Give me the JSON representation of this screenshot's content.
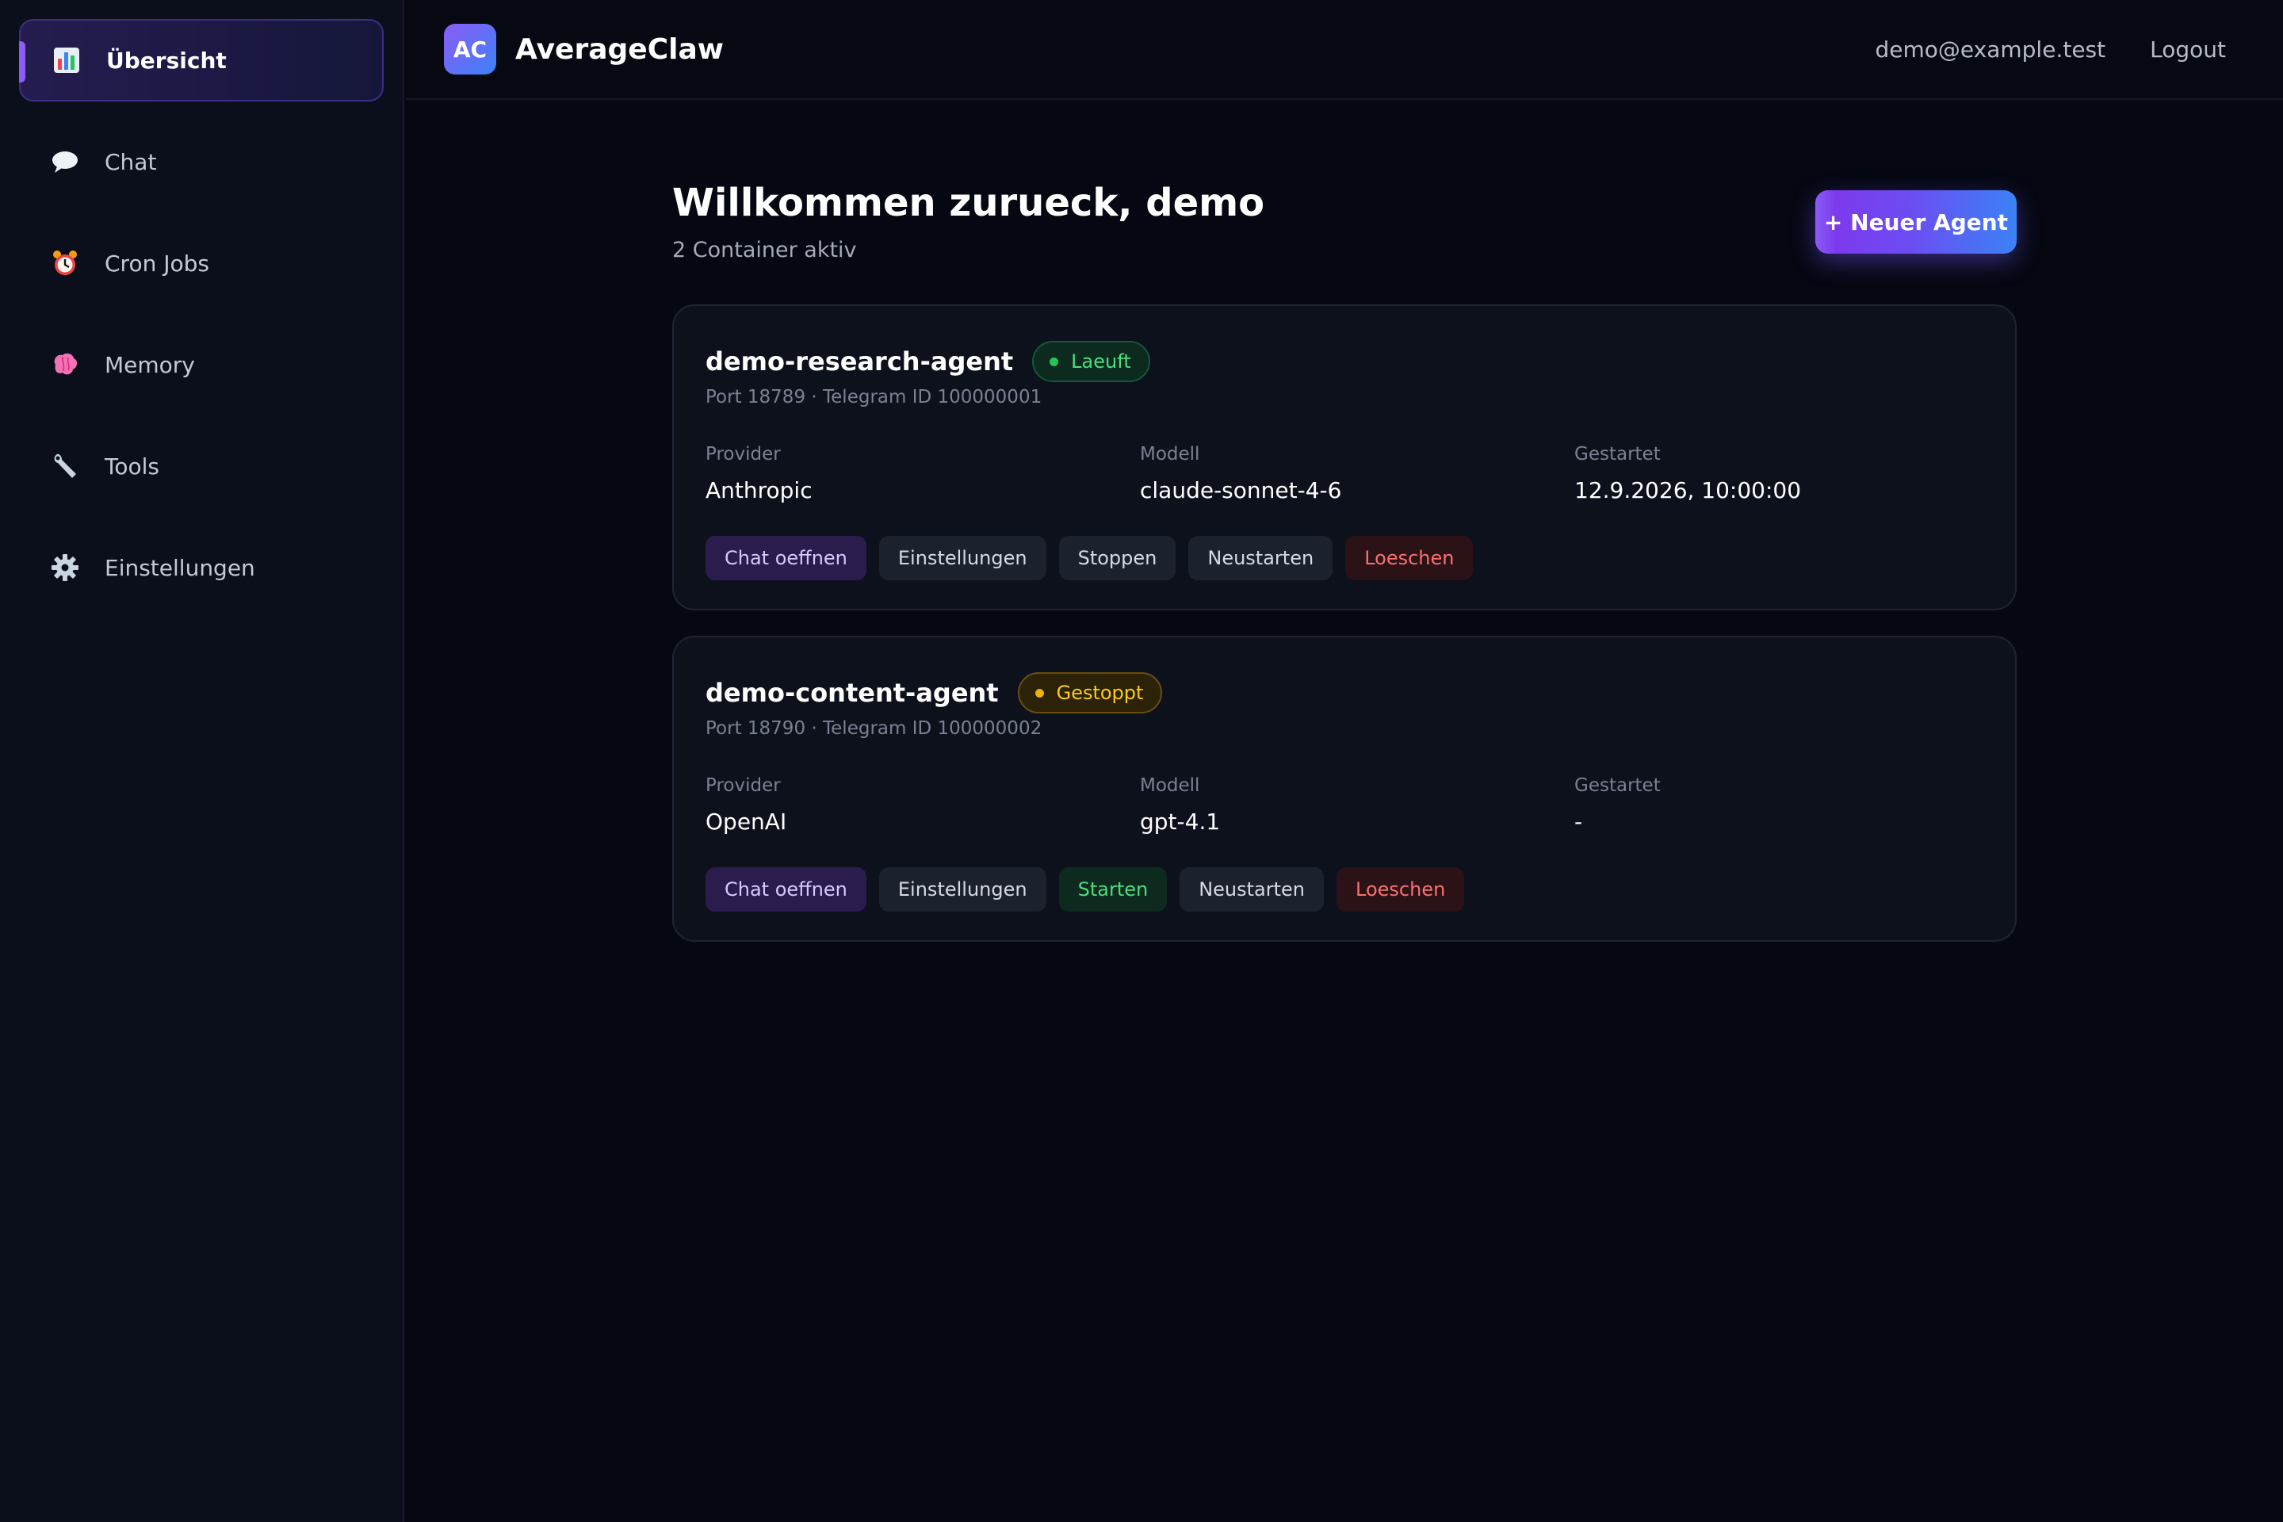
{
  "sidebar": {
    "items": [
      {
        "label": "Übersicht",
        "icon": "bar-chart-icon"
      },
      {
        "label": "Chat",
        "icon": "speech-bubble-icon"
      },
      {
        "label": "Cron Jobs",
        "icon": "alarm-clock-icon"
      },
      {
        "label": "Memory",
        "icon": "brain-icon"
      },
      {
        "label": "Tools",
        "icon": "wrench-icon"
      },
      {
        "label": "Einstellungen",
        "icon": "gear-icon"
      }
    ],
    "active_index": 0
  },
  "header": {
    "logo": "AC",
    "title": "AverageClaw",
    "user_email": "demo@example.test",
    "logout_label": "Logout"
  },
  "main": {
    "title": "Willkommen zurueck, demo",
    "subtitle": "2 Container aktiv",
    "new_agent_label": "+ Neuer Agent"
  },
  "labels": {
    "provider": "Provider",
    "model": "Modell",
    "started": "Gestartet"
  },
  "agents": [
    {
      "name": "demo-research-agent",
      "status": "Laeuft",
      "meta": "Port 18789 · Telegram ID 100000001",
      "provider": "Anthropic",
      "model": "claude-sonnet-4-6",
      "started": "12.9.2026, 10:00:00",
      "actions": {
        "chat": "Chat oeffnen",
        "settings": "Einstellungen",
        "toggle": "Stoppen",
        "restart": "Neustarten",
        "delete": "Loeschen"
      }
    },
    {
      "name": "demo-content-agent",
      "status": "Gestoppt",
      "meta": "Port 18790 · Telegram ID 100000002",
      "provider": "OpenAI",
      "model": "gpt-4.1",
      "started": "-",
      "actions": {
        "chat": "Chat oeffnen",
        "settings": "Einstellungen",
        "toggle": "Starten",
        "restart": "Neustarten",
        "delete": "Loeschen"
      }
    }
  ],
  "colors": {
    "accent": "#8b5cf6",
    "accent_blue": "#3b82f6",
    "running": "#22c55e",
    "stopped": "#eab308",
    "danger": "#f87171"
  }
}
